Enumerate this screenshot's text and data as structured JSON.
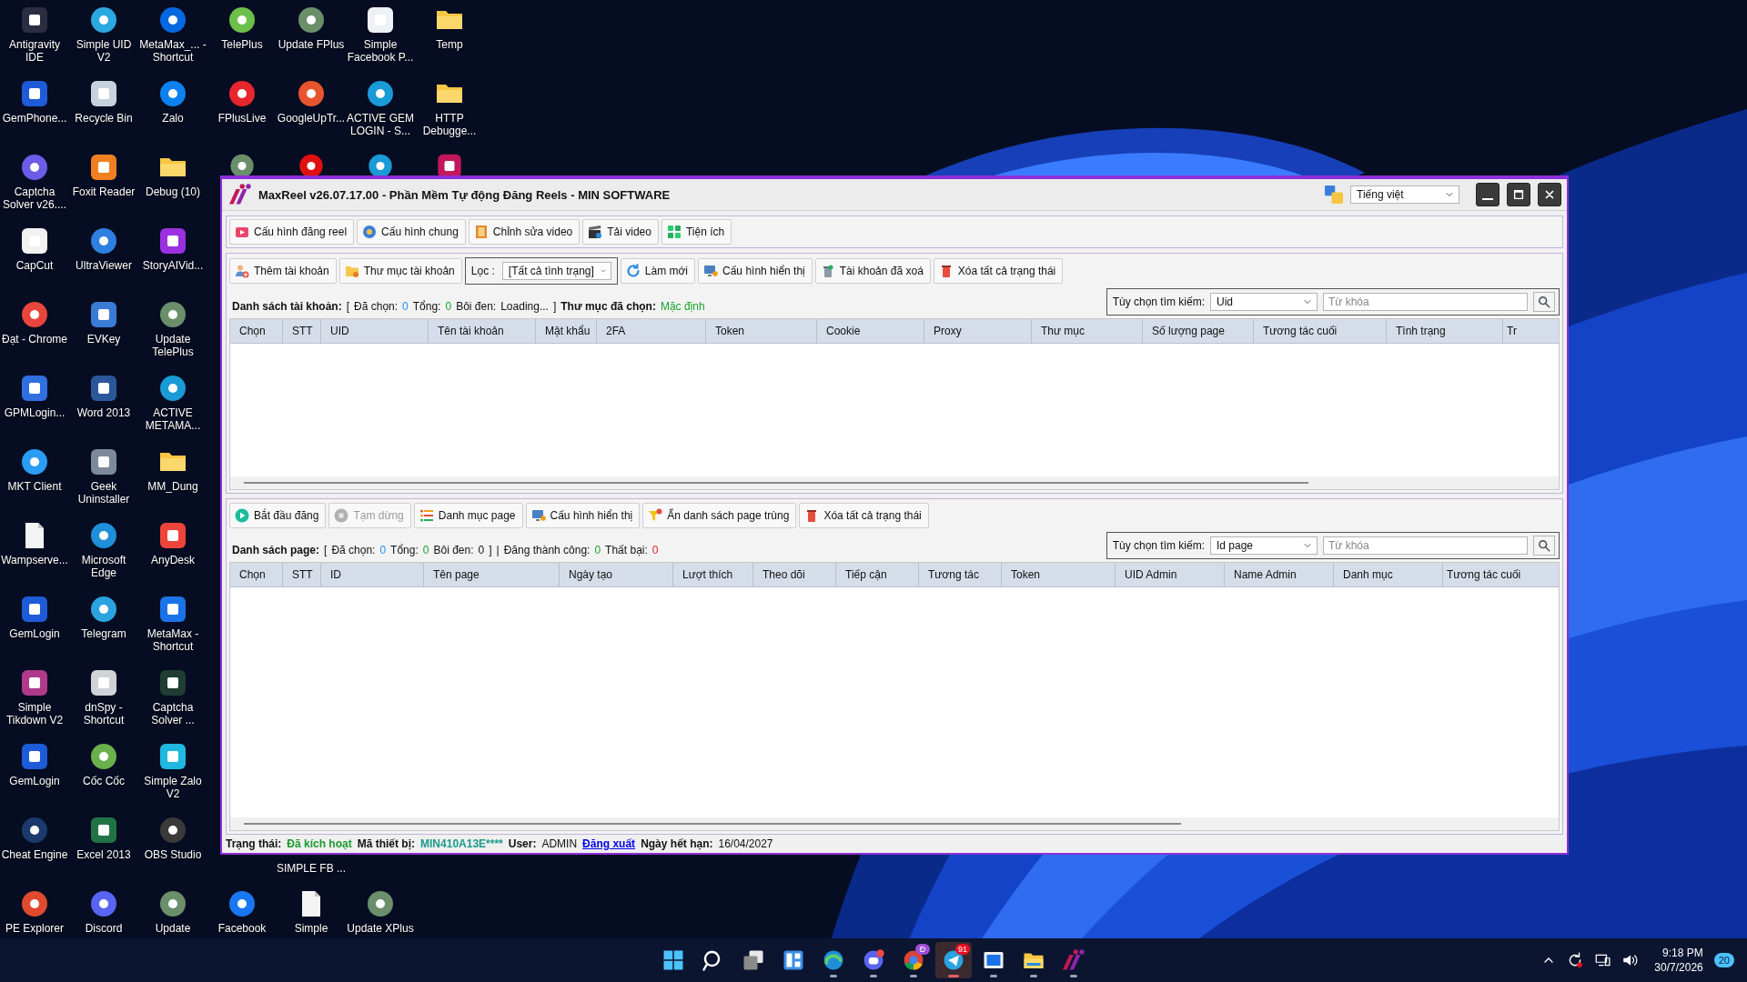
{
  "desktop": {
    "columns": [
      {
        "top": [
          {
            "label": "Antigravity IDE",
            "kind": "tile",
            "color": "#2b2d42"
          },
          {
            "label": "GemPhone...",
            "kind": "tile",
            "color": "#1e5bd8"
          },
          {
            "label": "Captcha Solver v26....",
            "kind": "app",
            "color": "#6c5ce7"
          },
          {
            "label": "CapCut",
            "kind": "tile",
            "color": "#f2f2f2"
          },
          {
            "label": "Đạt - Chrome",
            "kind": "app",
            "color": "#e8453c"
          },
          {
            "label": "GPMLogin...",
            "kind": "tile",
            "color": "#2f6fe0"
          },
          {
            "label": "MKT Client",
            "kind": "app",
            "color": "#2a9df4"
          },
          {
            "label": "Wampserve...",
            "kind": "file",
            "color": "#f4f4f4"
          },
          {
            "label": "GemLogin",
            "kind": "tile",
            "color": "#1e5bd8"
          },
          {
            "label": "Simple Tikdown V2",
            "kind": "tile",
            "color": "#b03a8a"
          },
          {
            "label": "GemLogin",
            "kind": "tile",
            "color": "#1e5bd8"
          },
          {
            "label": "Cheat Engine",
            "kind": "app",
            "color": "#1b3a6b"
          },
          {
            "label": "PE Explorer",
            "kind": "app",
            "color": "#e04a2f"
          }
        ]
      },
      {
        "top": [
          {
            "label": "Simple UID V2",
            "kind": "app",
            "color": "#2aa8e0"
          },
          {
            "label": "Recycle Bin",
            "kind": "tile",
            "color": "#c7d3dc"
          },
          {
            "label": "Foxit Reader",
            "kind": "tile",
            "color": "#f07f22"
          },
          {
            "label": "UltraViewer",
            "kind": "app",
            "color": "#2d7fe0"
          },
          {
            "label": "EVKey",
            "kind": "tile",
            "color": "#3a7bd5"
          },
          {
            "label": "Word 2013",
            "kind": "tile",
            "color": "#2b579a"
          },
          {
            "label": "Geek Uninstaller",
            "kind": "tile",
            "color": "#7d8a99"
          },
          {
            "label": "Microsoft Edge",
            "kind": "app",
            "color": "#1e8fd8"
          },
          {
            "label": "Telegram",
            "kind": "app",
            "color": "#2aa3e0"
          },
          {
            "label": "dnSpy - Shortcut",
            "kind": "tile",
            "color": "#d0d4d8"
          },
          {
            "label": "Cốc Cốc",
            "kind": "app",
            "color": "#6ab04c"
          },
          {
            "label": "Excel 2013",
            "kind": "tile",
            "color": "#217346"
          },
          {
            "label": "Discord",
            "kind": "app",
            "color": "#5865f2"
          }
        ]
      },
      {
        "top": [
          {
            "label": "MetaMax_... - Shortcut",
            "kind": "app",
            "color": "#0668e1"
          },
          {
            "label": "Zalo",
            "kind": "app",
            "color": "#0b82f0"
          },
          {
            "label": "Debug (10)",
            "kind": "folder",
            "color": "#f6c744"
          },
          {
            "label": "StoryAIVid...",
            "kind": "tile",
            "color": "#9b30e0"
          },
          {
            "label": "Update TelePlus",
            "kind": "app",
            "color": "#6b8e6b"
          },
          {
            "label": "ACTIVE METAMA...",
            "kind": "app",
            "color": "#1a9ad6"
          },
          {
            "label": "MM_Dung",
            "kind": "folder",
            "color": "#f6c744"
          },
          {
            "label": "AnyDesk",
            "kind": "tile",
            "color": "#ef443b"
          },
          {
            "label": "MetaMax - Shortcut",
            "kind": "tile",
            "color": "#1a73e8"
          },
          {
            "label": "Captcha Solver ...",
            "kind": "tile",
            "color": "#1f3d33"
          },
          {
            "label": "Simple Zalo V2",
            "kind": "tile",
            "color": "#1fb8e0"
          },
          {
            "label": "OBS Studio",
            "kind": "app",
            "color": "#3a3a3a"
          },
          {
            "label": "Update",
            "kind": "app",
            "color": "#6b8e6b"
          }
        ]
      },
      {
        "top": [
          {
            "label": "TelePlus",
            "kind": "app",
            "color": "#6cc04a"
          },
          {
            "label": "FPlusLive",
            "kind": "app",
            "color": "#e8262d"
          },
          {
            "kind": "app",
            "color": "#6b8e6b"
          }
        ],
        "bottom": [
          {
            "label": "Facebook",
            "kind": "app",
            "color": "#1877f2"
          }
        ]
      },
      {
        "top": [
          {
            "label": "Update FPlus",
            "kind": "app",
            "color": "#6b8e6b"
          },
          {
            "label": "GoogleUpTr...",
            "kind": "app",
            "color": "#e8542d"
          },
          {
            "kind": "app",
            "color": "#e01010"
          }
        ],
        "bottom": [
          {
            "label": "SIMPLE FB ...",
            "kind": "label"
          },
          {
            "label": "Simple",
            "kind": "file",
            "color": "#f4f4f4"
          }
        ]
      },
      {
        "top": [
          {
            "label": "Simple Facebook P...",
            "kind": "tile",
            "color": "#eef1f5"
          },
          {
            "label": "ACTIVE GEM LOGIN - S...",
            "kind": "app",
            "color": "#1a9ad6"
          },
          {
            "kind": "app",
            "color": "#1a9ad6"
          }
        ],
        "bottom": [
          {
            "label": "Update XPlus",
            "kind": "app",
            "color": "#6b8e6b"
          }
        ]
      },
      {
        "top": [
          {
            "label": "Temp",
            "kind": "folder",
            "color": "#f6c744"
          },
          {
            "label": "HTTP Debugge...",
            "kind": "folder",
            "color": "#f6c744"
          },
          {
            "kind": "tile",
            "color": "#c2185b"
          }
        ]
      }
    ]
  },
  "window": {
    "title": "MaxReel v26.07.17.00 - Phần Mềm Tự động Đăng Reels - MIN SOFTWARE",
    "language": "Tiếng việt"
  },
  "main_toolbar": [
    {
      "label": "Cấu hình đăng reel",
      "kind": "reel"
    },
    {
      "label": "Cấu hình chung",
      "kind": "gear"
    },
    {
      "label": "Chỉnh sửa video",
      "kind": "film"
    },
    {
      "label": "Tải video",
      "kind": "clapper"
    },
    {
      "label": "Tiện ích",
      "kind": "grid"
    }
  ],
  "accounts": {
    "toolbar": [
      {
        "label": "Thêm tài khoản",
        "kind": "user_add"
      },
      {
        "label": "Thư mục tài khoản",
        "kind": "folder"
      }
    ],
    "filter": {
      "label": "Lọc :",
      "value": "[Tất cả tình trạng]"
    },
    "actions": [
      {
        "label": "Làm mới",
        "kind": "refresh"
      },
      {
        "label": "Cấu hình hiển thị",
        "kind": "monitor"
      },
      {
        "label": "Tài khoản đã xoá",
        "kind": "trash"
      },
      {
        "label": "Xóa tất cả trạng thái",
        "kind": "bin"
      }
    ],
    "summary": [
      {
        "text": "Danh sách tài khoản:",
        "kind": "label"
      },
      {
        "text": "[",
        "kind": "plain"
      },
      {
        "text": "Đã chọn:",
        "kind": "plain"
      },
      {
        "text": "0",
        "kind": "count"
      },
      {
        "text": "Tổng:",
        "kind": "plain"
      },
      {
        "text": "0",
        "kind": "accent"
      },
      {
        "text": "Bôi đen:",
        "kind": "plain"
      },
      {
        "text": "Loading...",
        "kind": "plain"
      },
      {
        "text": "]",
        "kind": "plain"
      },
      {
        "text": "Thư mục đã chọn:",
        "kind": "label"
      },
      {
        "text": "Mặc định",
        "kind": "accent"
      }
    ],
    "search": {
      "label": "Tùy chọn tìm kiếm:",
      "option": "Uid",
      "placeholder": "Từ khóa"
    },
    "columns": [
      "Chọn",
      "STT",
      "UID",
      "Tên tài khoản",
      "Mật khẩu",
      "2FA",
      "Token",
      "Cookie",
      "Proxy",
      "Thư mục",
      "Số lượng page",
      "Tương tác cuối",
      "Tình trạng",
      "Tr"
    ]
  },
  "pages": {
    "toolbar": [
      {
        "label": "Bắt đầu đăng",
        "kind": "play",
        "disabled": false
      },
      {
        "label": "Tạm dừng",
        "kind": "stop",
        "disabled": true
      },
      {
        "label": "Danh mục page",
        "kind": "list",
        "disabled": false
      },
      {
        "label": "Cấu hình hiển thị",
        "kind": "monitor",
        "disabled": false
      },
      {
        "label": "Ẩn danh sách page trùng",
        "kind": "filter",
        "disabled": false
      },
      {
        "label": "Xóa tất cả trạng thái",
        "kind": "bin",
        "disabled": false
      }
    ],
    "summary": [
      {
        "text": "Danh sách page:",
        "kind": "label"
      },
      {
        "text": "[",
        "kind": "plain"
      },
      {
        "text": "Đã chọn:",
        "kind": "plain"
      },
      {
        "text": "0",
        "kind": "count"
      },
      {
        "text": "Tổng:",
        "kind": "plain"
      },
      {
        "text": "0",
        "kind": "accent"
      },
      {
        "text": "Bôi đen:",
        "kind": "plain"
      },
      {
        "text": "0",
        "kind": "plain"
      },
      {
        "text": "]",
        "kind": "plain"
      },
      {
        "text": "|",
        "kind": "plain"
      },
      {
        "text": "Đăng thành công:",
        "kind": "plain"
      },
      {
        "text": "0",
        "kind": "accent"
      },
      {
        "text": "Thất bại:",
        "kind": "plain"
      },
      {
        "text": "0",
        "kind": "danger"
      }
    ],
    "search": {
      "label": "Tùy chọn tìm kiếm:",
      "option": "Id page",
      "placeholder": "Từ khóa"
    },
    "columns": [
      "Chọn",
      "STT",
      "ID",
      "Tên page",
      "Ngày tạo",
      "Lượt thích",
      "Theo dõi",
      "Tiếp cận",
      "Tương tác",
      "Token",
      "UID Admin",
      "Name Admin",
      "Danh mục",
      "Tương tác cuối"
    ]
  },
  "status_bar": [
    {
      "text": "Trạng thái:",
      "kind": "label"
    },
    {
      "text": "Đã kích hoạt",
      "kind": "ok"
    },
    {
      "text": "Mã thiết bị:",
      "kind": "label"
    },
    {
      "text": "MIN410A13E****",
      "kind": "code"
    },
    {
      "text": "User:",
      "kind": "label"
    },
    {
      "text": "ADMIN",
      "kind": "plain"
    },
    {
      "text": "Đăng xuất",
      "kind": "link"
    },
    {
      "text": "Ngày hết hạn:",
      "kind": "label"
    },
    {
      "text": "16/04/2027",
      "kind": "plain"
    }
  ],
  "taskbar": {
    "items": [
      {
        "kind": "start",
        "running": false,
        "selected": false
      },
      {
        "kind": "search",
        "running": false,
        "selected": false
      },
      {
        "kind": "taskview",
        "running": false,
        "selected": false
      },
      {
        "kind": "widgets",
        "running": false,
        "selected": false
      },
      {
        "kind": "edge",
        "running": true,
        "selected": false
      },
      {
        "kind": "discord",
        "running": true,
        "selected": false
      },
      {
        "kind": "chrome",
        "running": true,
        "selected": false,
        "badge": "Đ"
      },
      {
        "kind": "telegram",
        "running": true,
        "selected": true,
        "badge": "91"
      },
      {
        "kind": "viewer",
        "running": true,
        "selected": false
      },
      {
        "kind": "folder",
        "running": true,
        "selected": false
      },
      {
        "kind": "maxreel",
        "running": true,
        "selected": false
      }
    ],
    "time": "9:18 PM",
    "date": "30/7/2026",
    "notifications": "20"
  }
}
